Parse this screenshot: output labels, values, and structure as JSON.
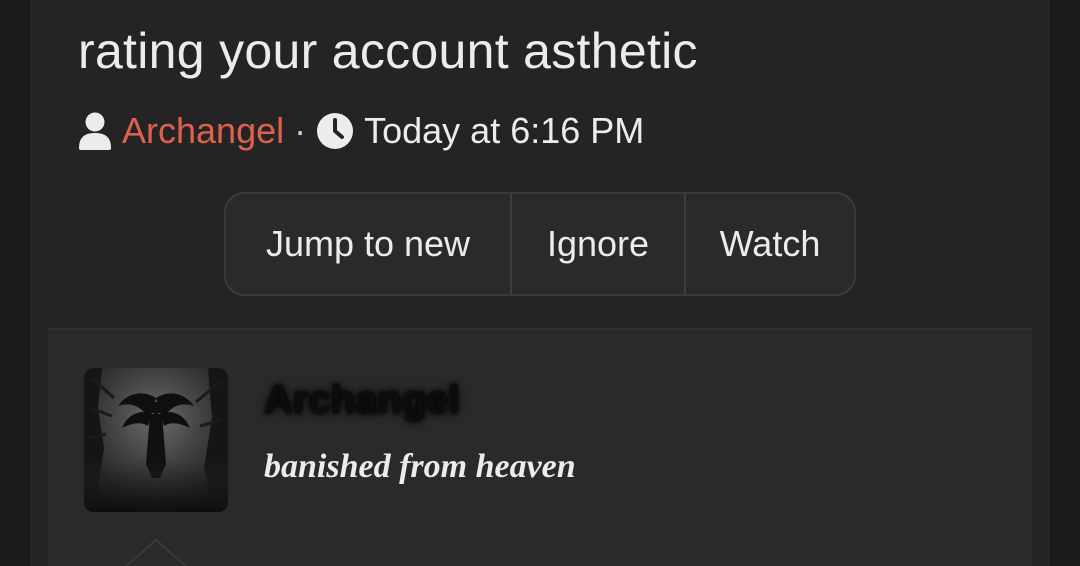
{
  "thread": {
    "title": "rating your account asthetic",
    "author": "Archangel",
    "separator": "·",
    "date": "Today at 6:16 PM"
  },
  "actions": {
    "jump_to_new": "Jump to new",
    "ignore": "Ignore",
    "watch": "Watch"
  },
  "post": {
    "author": "Archangel",
    "user_title": "banished from heaven"
  },
  "icons": {
    "author": "user-icon",
    "date": "clock-icon"
  },
  "colors": {
    "author_link": "#e0604f",
    "text": "#ececec",
    "panel": "#242424",
    "background": "#1a1a1a"
  }
}
